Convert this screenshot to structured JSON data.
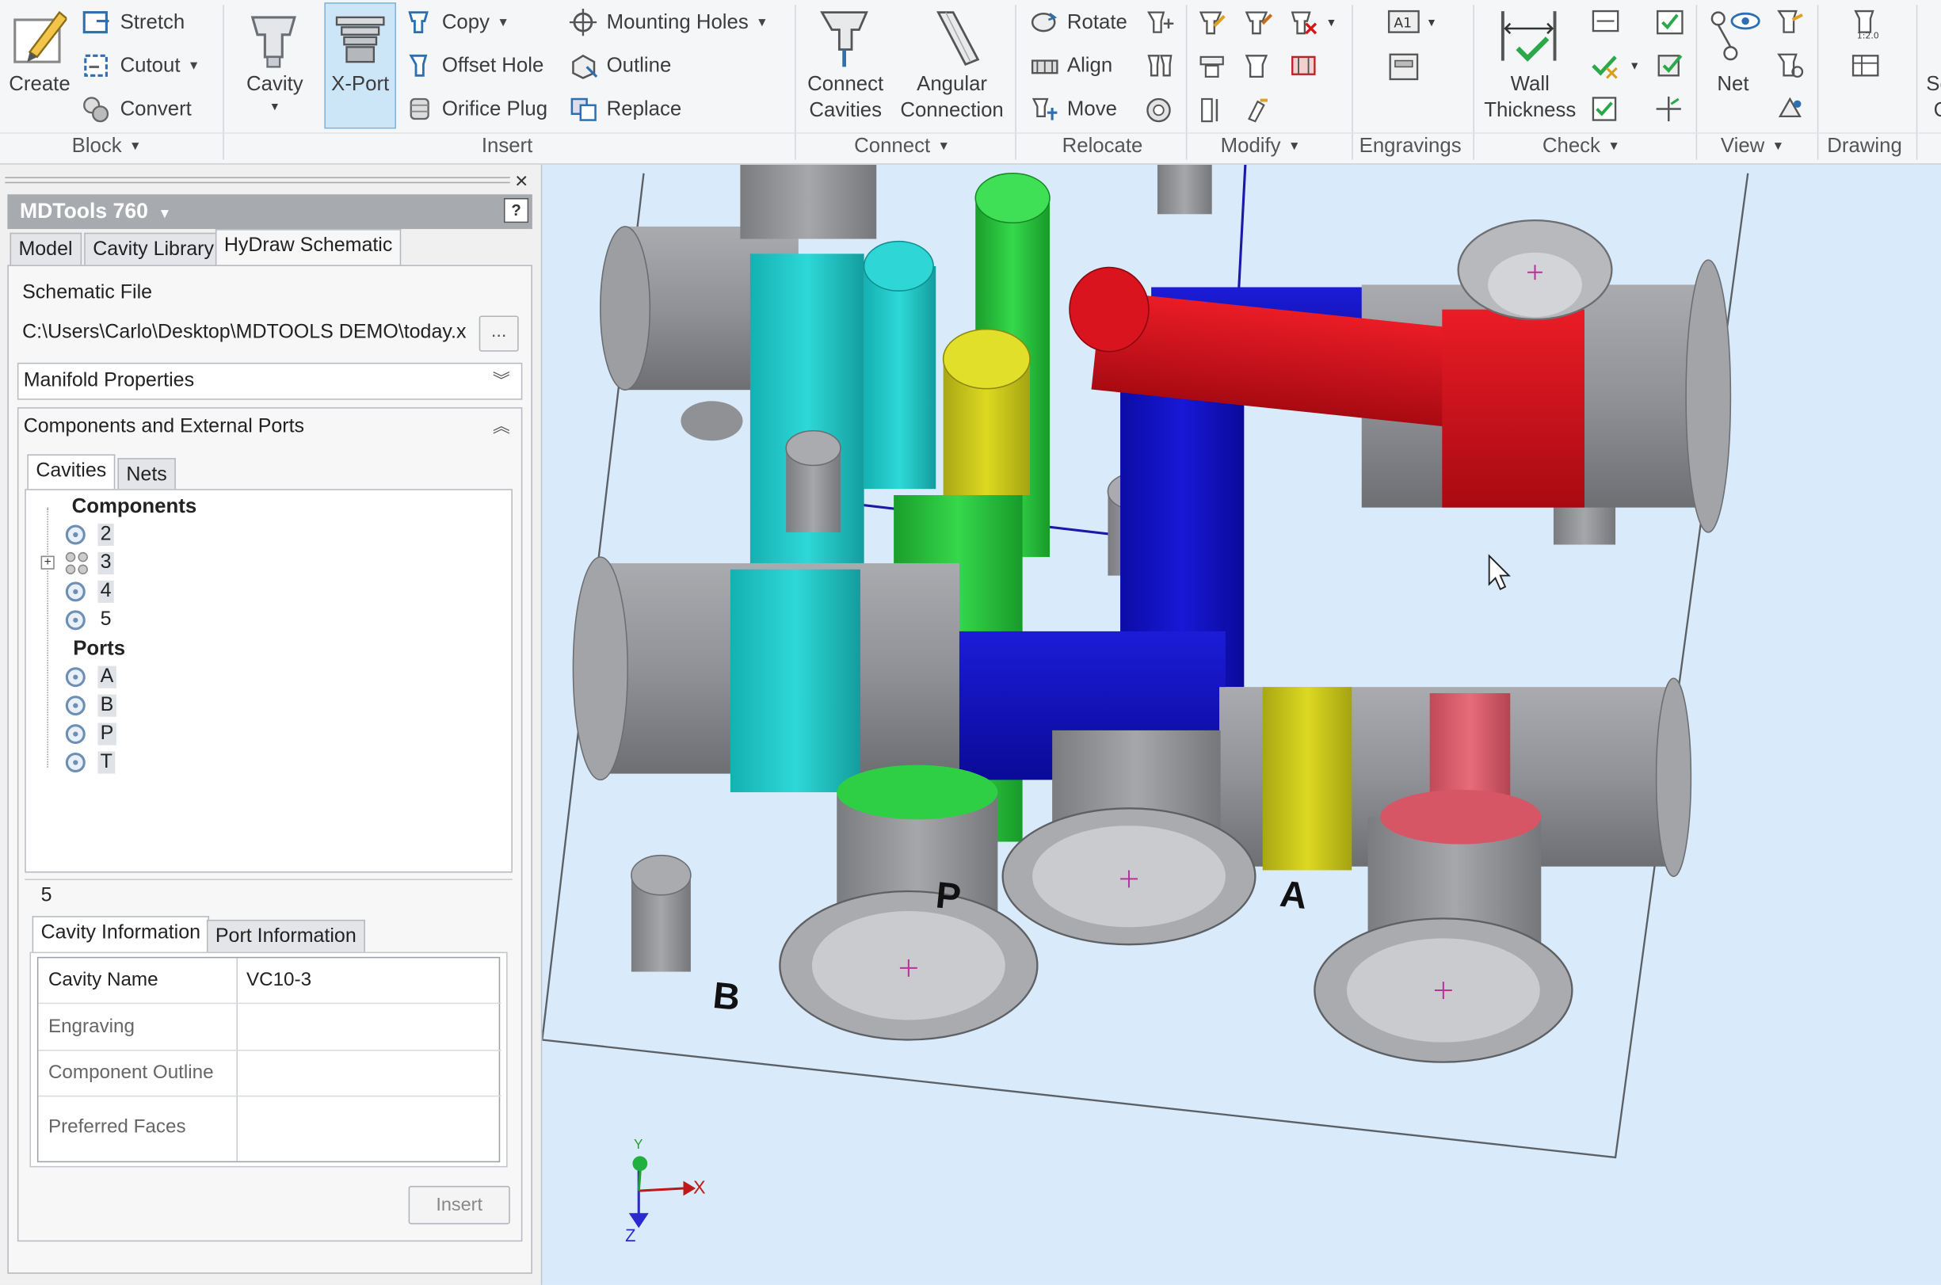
{
  "ribbon": {
    "block": {
      "create_label": "Create",
      "stretch_label": "Stretch",
      "cutout_label": "Cutout",
      "convert_label": "Convert",
      "group_label": "Block"
    },
    "insert": {
      "cavity_label": "Cavity",
      "xport_label": "X-Port",
      "copy_label": "Copy",
      "offset_hole_label": "Offset Hole",
      "orifice_plug_label": "Orifice Plug",
      "mounting_holes_label": "Mounting Holes",
      "outline_label": "Outline",
      "replace_label": "Replace",
      "group_label": "Insert"
    },
    "connect": {
      "connect_cavities_l1": "Connect",
      "connect_cavities_l2": "Cavities",
      "angular_l1": "Angular",
      "angular_l2": "Connection",
      "group_label": "Connect"
    },
    "relocate": {
      "rotate_label": "Rotate",
      "align_label": "Align",
      "move_label": "Move",
      "group_label": "Relocate"
    },
    "modify": {
      "group_label": "Modify"
    },
    "engravings": {
      "group_label": "Engravings"
    },
    "check": {
      "wall_l1": "Wall",
      "wall_l2": "Thickness",
      "group_label": "Check"
    },
    "view": {
      "net_label": "Net",
      "group_label": "View"
    },
    "drawing": {
      "group_label": "Drawing"
    },
    "partial_label_1": "Se",
    "partial_label_2": "C"
  },
  "panel": {
    "title": "MDTools 760",
    "help": "?",
    "close": "×",
    "tabs": [
      "Model",
      "Cavity Library",
      "HyDraw Schematic"
    ],
    "schematic_file_label": "Schematic File",
    "schematic_file_path": "C:\\Users\\Carlo\\Desktop\\MDTOOLS DEMO\\today.x",
    "browse_label": "...",
    "manifold_properties": "Manifold Properties",
    "components_ports_label": "Components and External Ports",
    "subtabs": [
      "Cavities",
      "Nets"
    ],
    "tree": {
      "components_label": "Components",
      "components": [
        "2",
        "3",
        "4",
        "5"
      ],
      "ports_label": "Ports",
      "ports": [
        "A",
        "B",
        "P",
        "T"
      ]
    },
    "selected": "5",
    "info_tabs": [
      "Cavity Information",
      "Port Information"
    ],
    "info_rows": [
      {
        "label": "Cavity Name",
        "value": "VC10-3"
      },
      {
        "label": "Engraving",
        "value": ""
      },
      {
        "label": "Component Outline",
        "value": ""
      },
      {
        "label": "Preferred Faces",
        "value": ""
      }
    ],
    "insert_button": "Insert"
  },
  "viewport": {
    "port_labels": {
      "p": "P",
      "a": "A",
      "b": "B"
    },
    "axes": {
      "x": "X",
      "y": "Y",
      "z": "Z"
    },
    "colors": {
      "background": "#d9ebfa",
      "cyan": "#1ec7c7",
      "green": "#23c23a",
      "yellow": "#cfcc1a",
      "blue": "#1414c8",
      "red": "#d4101a",
      "pink": "#e0606e",
      "grey": "#8d8f94"
    }
  }
}
